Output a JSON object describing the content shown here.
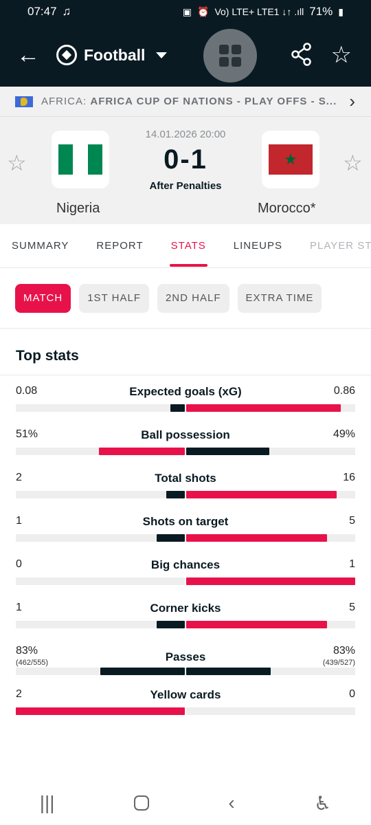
{
  "status_bar": {
    "time": "07:47",
    "network": "Vo) LTE+ LTE1 ↓↑ .ıll",
    "battery": "71%"
  },
  "header": {
    "sport": "Football"
  },
  "league": {
    "region": "AFRICA:",
    "name": "AFRICA CUP OF NATIONS - PLAY OFFS - S..."
  },
  "match": {
    "datetime": "14.01.2026 20:00",
    "score": "0-1",
    "status": "After Penalties",
    "home": {
      "name": "Nigeria"
    },
    "away": {
      "name": "Morocco*"
    }
  },
  "tabs": [
    "SUMMARY",
    "REPORT",
    "STATS",
    "LINEUPS",
    "PLAYER STA"
  ],
  "period_chips": [
    "MATCH",
    "1ST HALF",
    "2ND HALF",
    "EXTRA TIME"
  ],
  "section_title": "Top stats",
  "stats": [
    {
      "label": "Expected goals (xG)",
      "home": "0.08",
      "away": "0.86",
      "home_share": 0.085,
      "away_share": 0.915,
      "winner": "away"
    },
    {
      "label": "Ball possession",
      "home": "51%",
      "away": "49%",
      "home_share": 0.51,
      "away_share": 0.49,
      "winner": "home"
    },
    {
      "label": "Total shots",
      "home": "2",
      "away": "16",
      "home_share": 0.111,
      "away_share": 0.889,
      "winner": "away"
    },
    {
      "label": "Shots on target",
      "home": "1",
      "away": "5",
      "home_share": 0.167,
      "away_share": 0.833,
      "winner": "away"
    },
    {
      "label": "Big chances",
      "home": "0",
      "away": "1",
      "home_share": 0.0,
      "away_share": 1.0,
      "winner": "away"
    },
    {
      "label": "Corner kicks",
      "home": "1",
      "away": "5",
      "home_share": 0.167,
      "away_share": 0.833,
      "winner": "away"
    },
    {
      "label": "Passes",
      "home": "83%",
      "home_sub": "(462/555)",
      "away": "83%",
      "away_sub": "(439/527)",
      "home_share": 0.5,
      "away_share": 0.5,
      "winner": "none"
    },
    {
      "label": "Yellow cards",
      "home": "2",
      "away": "0",
      "home_share": 1.0,
      "away_share": 0.0,
      "winner": "home"
    }
  ],
  "colors": {
    "accent": "#e8124a",
    "dark": "#0a1a22",
    "track": "#eeeeee",
    "nigeria_green": "#008751",
    "morocco_red": "#c1272d"
  },
  "icons": {
    "back": "arrow-left-icon",
    "sport": "football-icon",
    "menu": "grid-icon",
    "share": "share-icon",
    "favorite": "star-icon",
    "chevron": "chevron-right-icon"
  },
  "nav": {
    "recents": "|||",
    "back": "‹"
  }
}
